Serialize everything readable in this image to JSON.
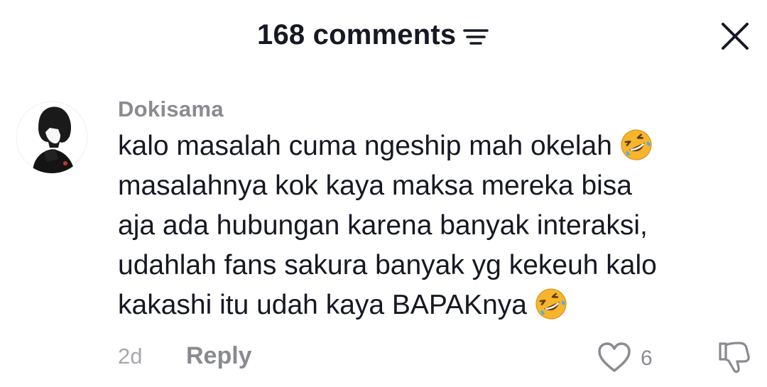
{
  "header": {
    "title": "168 comments",
    "sort_icon": "sort-lines-icon",
    "close_icon": "close-icon"
  },
  "comment": {
    "avatar": "user-avatar",
    "username": "Dokisama",
    "lines": [
      "kalo masalah cuma ngeship mah okelah",
      "masalahnya kok kaya maksa mereka bisa",
      "aja ada hubungan karena banyak interaksi,",
      "udahlah fans sakura banyak yg kekeuh kalo",
      "kakashi itu udah kaya BAPAKnya"
    ],
    "emoji": "rolling-on-floor-laughing-emoji",
    "time": "2d",
    "reply_label": "Reply",
    "like_count": "6",
    "like_icon": "heart-outline-icon",
    "dislike_icon": "thumbs-down-icon"
  },
  "colors": {
    "text_primary": "#161823",
    "text_secondary": "#8a8b91",
    "emoji_face": "#f6b52c"
  }
}
